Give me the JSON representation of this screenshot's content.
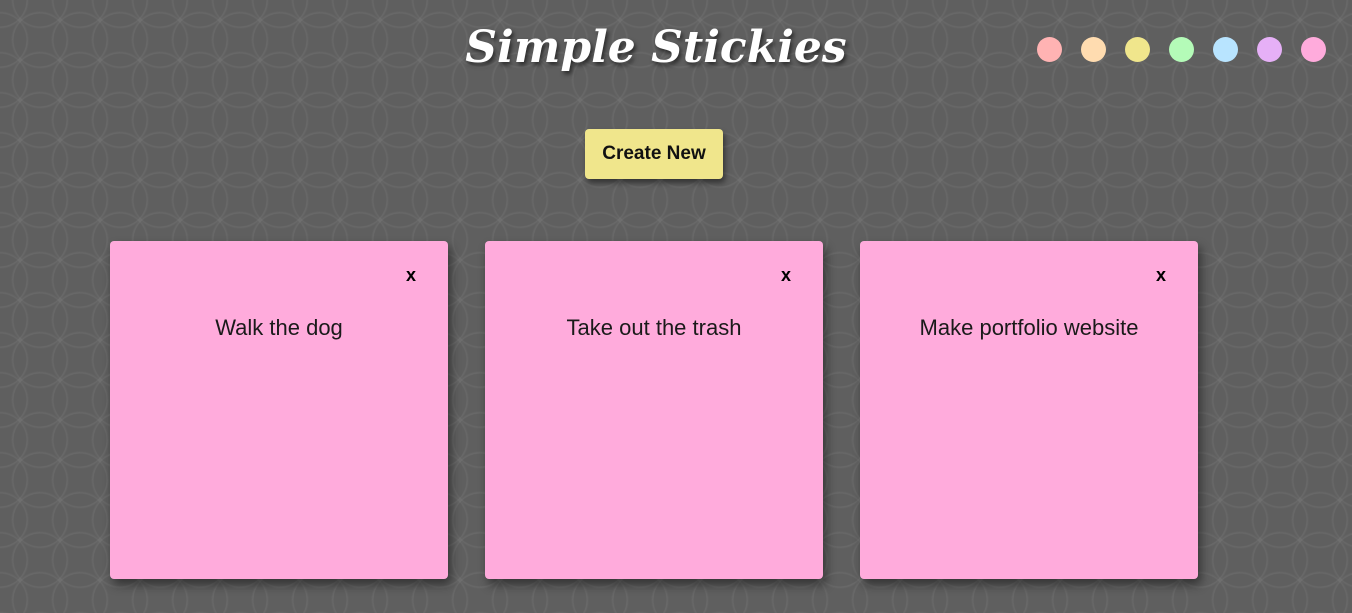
{
  "header": {
    "title": "Simple Stickies"
  },
  "palette": [
    {
      "name": "red",
      "color": "#ffb3b3"
    },
    {
      "name": "orange",
      "color": "#ffdcb0"
    },
    {
      "name": "yellow",
      "color": "#f0e68c"
    },
    {
      "name": "green",
      "color": "#b4fbb8"
    },
    {
      "name": "blue",
      "color": "#b8e4ff"
    },
    {
      "name": "purple",
      "color": "#e6b0f7"
    },
    {
      "name": "pink",
      "color": "#ffabdc"
    }
  ],
  "toolbar": {
    "create_label": "Create New",
    "create_color": "#f0e68c"
  },
  "notes": [
    {
      "text": "Walk the dog",
      "close_label": "x",
      "color": "#ffabdc"
    },
    {
      "text": "Take out the trash",
      "close_label": "x",
      "color": "#ffabdc"
    },
    {
      "text": "Make portfolio website",
      "close_label": "x",
      "color": "#ffabdc"
    }
  ]
}
